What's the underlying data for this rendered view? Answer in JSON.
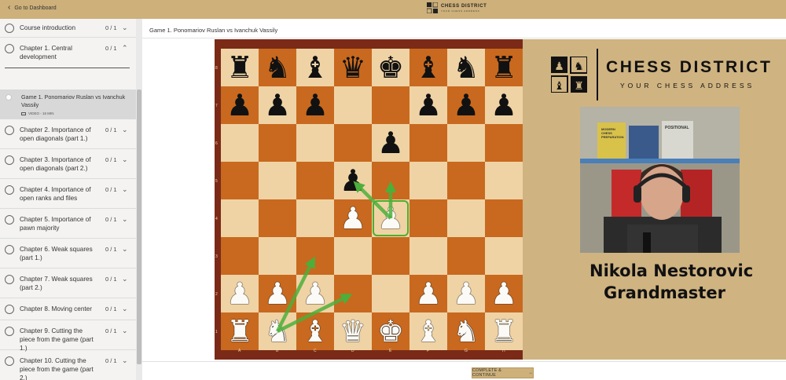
{
  "topbar": {
    "back_label": "Go to Dashboard",
    "brand_name": "CHESS DISTRICT",
    "brand_tagline": "YOUR CHESS ADDRESS",
    "color": "#cdb07a"
  },
  "sidebar": {
    "chapters": [
      {
        "title": "Course introduction",
        "count": "0 / 1",
        "expanded": false
      },
      {
        "title": "Chapter 1. Central development",
        "count": "0 / 1",
        "expanded": true
      },
      {
        "title": "Chapter 2. Importance of open diagonals (part 1.)",
        "count": "0 / 1",
        "expanded": false
      },
      {
        "title": "Chapter 3. Importance of open diagonals (part 2.)",
        "count": "0 / 1",
        "expanded": false
      },
      {
        "title": "Chapter 4. Importance of open ranks and files",
        "count": "0 / 1",
        "expanded": false
      },
      {
        "title": "Chapter 5. Importance of pawn majority",
        "count": "0 / 1",
        "expanded": false
      },
      {
        "title": "Chapter 6. Weak squares (part 1.)",
        "count": "0 / 1",
        "expanded": false
      },
      {
        "title": "Chapter 7. Weak squares (part 2.)",
        "count": "0 / 1",
        "expanded": false
      },
      {
        "title": "Chapter 8. Moving center",
        "count": "0 / 1",
        "expanded": false
      },
      {
        "title": "Chapter 9. Cutting the piece from the game (part 1.)",
        "count": "0 / 1",
        "expanded": false
      },
      {
        "title": "Chapter 10. Cutting the piece from the game (part 2.)",
        "count": "0 / 1",
        "expanded": false
      }
    ],
    "current_lesson": {
      "title": "Game 1. Ponomariov Ruslan vs Ivanchuk Vassily",
      "meta": "VIDEO - 16 MIN"
    }
  },
  "main": {
    "lesson_header": "Game 1. Ponomariov Ruslan vs Ivanchuk Vassily",
    "complete_button": "COMPLETE & CONTINUE",
    "complete_arrow": "→"
  },
  "board": {
    "ranks": [
      "8",
      "7",
      "6",
      "5",
      "4",
      "3",
      "2",
      "1"
    ],
    "files": [
      "A",
      "B",
      "C",
      "D",
      "E",
      "F",
      "G",
      "H"
    ],
    "light_color": "#efd3a5",
    "dark_color": "#c8691f",
    "position": [
      [
        "r",
        "n",
        "b",
        "q",
        "k",
        "b",
        "n",
        "r"
      ],
      [
        "p",
        "p",
        "p",
        "",
        "",
        "p",
        "p",
        "p"
      ],
      [
        "",
        "",
        "",
        "",
        "p",
        "",
        "",
        ""
      ],
      [
        "",
        "",
        "",
        "p",
        "",
        "",
        "",
        ""
      ],
      [
        "",
        "",
        "",
        "P",
        "P",
        "",
        "",
        ""
      ],
      [
        "",
        "",
        "",
        "",
        "",
        "",
        "",
        ""
      ],
      [
        "P",
        "P",
        "P",
        "",
        "",
        "P",
        "P",
        "P"
      ],
      [
        "R",
        "N",
        "B",
        "Q",
        "K",
        "B",
        "N",
        "R"
      ]
    ],
    "highlighted_square": "e4",
    "arrows": [
      {
        "from": "e4",
        "to": "e5"
      },
      {
        "from": "e4",
        "to": "d5"
      },
      {
        "from": "b1",
        "to": "c3"
      },
      {
        "from": "b1",
        "to": "d2"
      }
    ],
    "arrow_color": "#4caf3a"
  },
  "video_panel": {
    "brand_name": "CHESS DISTRICT",
    "brand_tagline": "YOUR CHESS ADDRESS",
    "presenter_name": "Nikola Nestorovic",
    "presenter_title": "Grandmaster",
    "panel_color": "#cfb381",
    "book_spines": [
      "MODERN CHESS PREPARATION",
      "POSITIONAL"
    ]
  }
}
